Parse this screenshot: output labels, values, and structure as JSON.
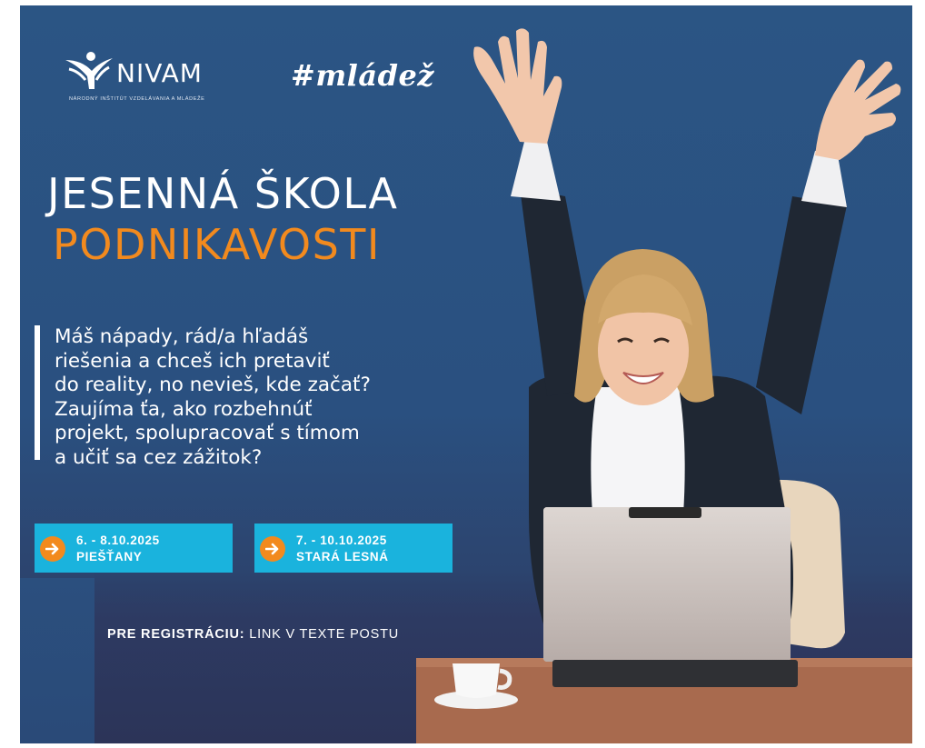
{
  "logo": {
    "name": "NIVAM",
    "subtitle": "NÁRODNÝ INŠTITÚT VZDELÁVANIA A MLÁDEŽE"
  },
  "hashtag": "#mládež",
  "headline": {
    "line1": "JESENNÁ ŠKOLA",
    "line2": "PODNIKAVOSTI"
  },
  "body": {
    "lines": [
      "Máš nápady, rád/a hľadáš",
      "riešenia a chceš ich pretaviť",
      "do reality, no nevieš, kde začať?",
      "Zaujíma ťa, ako rozbehnúť",
      "projekt, spolupracovať s tímom",
      "a učiť sa cez zážitok?"
    ]
  },
  "events": [
    {
      "date": "6. - 8.10.2025",
      "place": "PIEŠŤANY"
    },
    {
      "date": "7. - 10.10.2025",
      "place": "STARÁ LESNÁ"
    }
  ],
  "registration": {
    "label": "PRE REGISTRÁCIU:",
    "text": "LINK V TEXTE POSTU"
  },
  "colors": {
    "background": "#2b5584",
    "accent_orange": "#f28a1e",
    "accent_cyan": "#1ab3dd",
    "text": "#ffffff"
  },
  "icons": {
    "logo": "nivam-figure-icon",
    "event_arrow": "arrow-right-icon"
  }
}
